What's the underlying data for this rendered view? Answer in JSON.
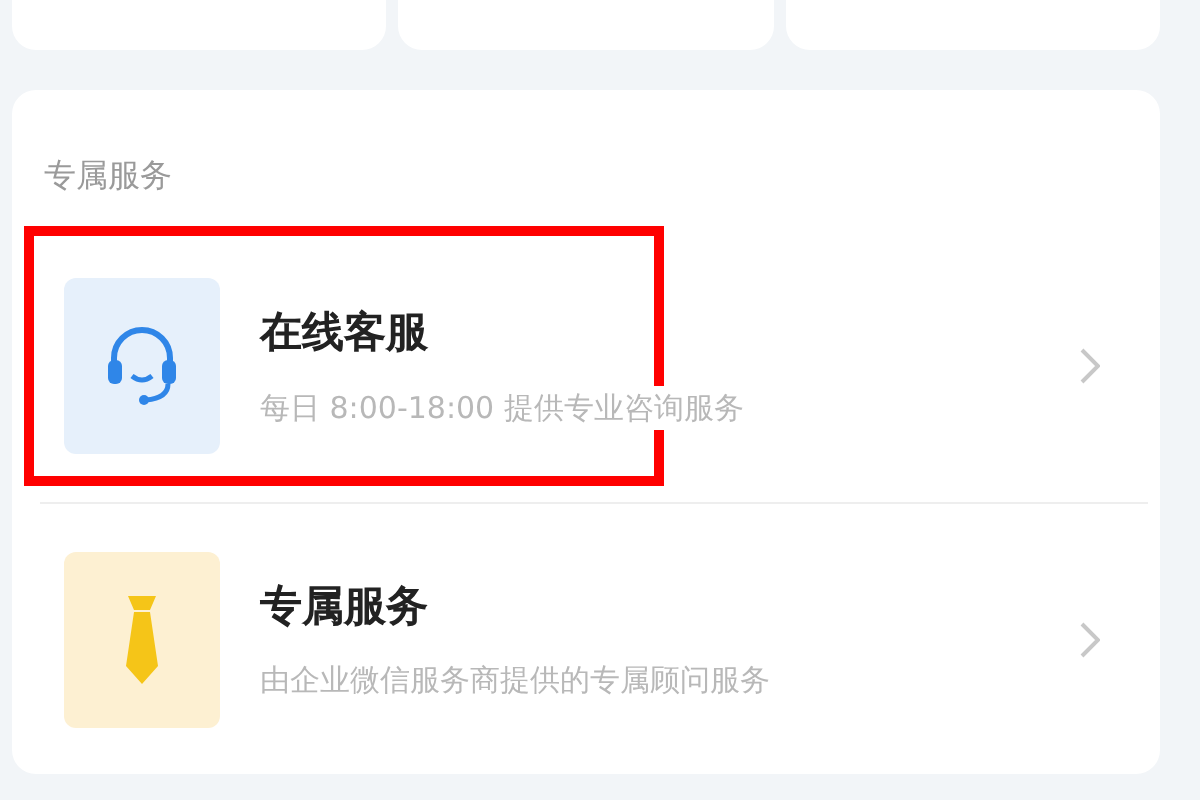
{
  "top_cards": [
    {
      "kind": "blank"
    },
    {
      "kind": "blank"
    },
    {
      "kind": "blank"
    }
  ],
  "section": {
    "title": "专属服务",
    "items": [
      {
        "kind": "headset",
        "title": "在线客服",
        "subtitle": "每日 8:00-18:00 提供专业咨询服务",
        "highlighted": true
      },
      {
        "kind": "tie",
        "title": "专属服务",
        "subtitle": "由企业微信服务商提供的专属顾问服务",
        "highlighted": false
      }
    ]
  }
}
